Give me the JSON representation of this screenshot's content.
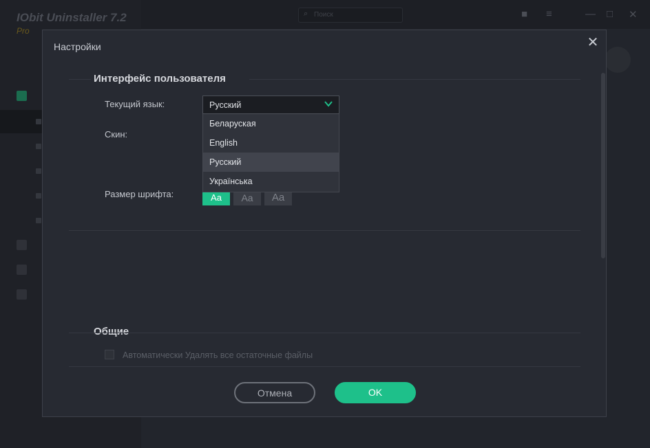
{
  "app": {
    "title": "IObit Uninstaller 7.2",
    "edition": "Pro",
    "search_placeholder": "Поиск"
  },
  "dialog": {
    "title": "Настройки",
    "sections": {
      "ui_title": "Интерфейс пользователя",
      "general_title": "Общие"
    },
    "labels": {
      "language": "Текущий язык:",
      "skin": "Скин:",
      "font_size": "Размер шрифта:"
    },
    "language_select": {
      "value": "Русский",
      "options": [
        "Беларуская",
        "English",
        "Русский",
        "Українська"
      ],
      "highlighted": "Русский"
    },
    "font_sizes": [
      "Aa",
      "Aa",
      "Aa"
    ],
    "font_size_selected": "Aa (small)",
    "general_checkbox_label": "Автоматически Удалять все остаточные файлы",
    "buttons": {
      "cancel": "Отмена",
      "ok": "OK"
    }
  },
  "colors": {
    "accent": "#1ec08a",
    "dialog_bg": "#272a32",
    "backdrop": "#1c1e24"
  },
  "icons": [
    "search-icon",
    "close-icon",
    "chevron-down-icon",
    "gift-icon",
    "menu-icon",
    "minimize-icon",
    "maximize-icon",
    "window-close-icon"
  ]
}
